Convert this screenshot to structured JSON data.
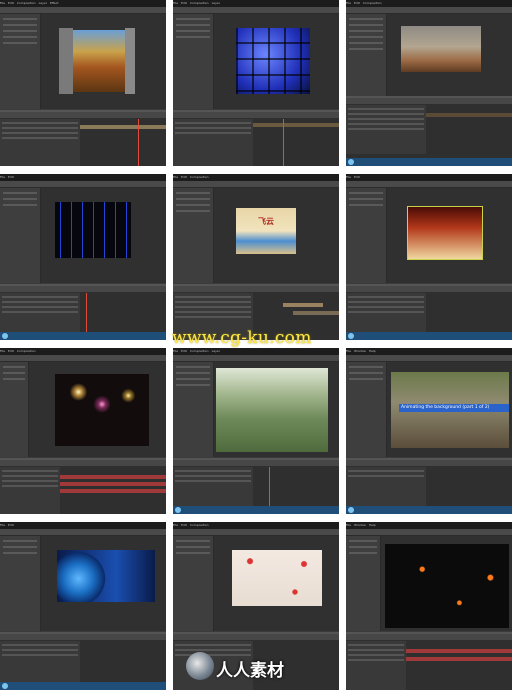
{
  "menu_items": [
    "File",
    "Edit",
    "Composition",
    "Layer",
    "Effect",
    "Animation",
    "View",
    "Window",
    "Help"
  ],
  "watermark_text": "www.cg-ku.com",
  "logo_text": "人人素材",
  "overlay_caption": "Animating the background (part 1 of 2)",
  "caption_tag": "飞云",
  "colors": {
    "app_background": "#3b3b3b",
    "timeline_background": "#2f2f2f",
    "taskbar": "#1f4f78",
    "playhead": "#e24b3b",
    "watermark": "#ffe84a",
    "caption_bar": "#2a63c9"
  },
  "tiles": [
    {
      "id": "tile-1",
      "preview": "autumn-forest-scene"
    },
    {
      "id": "tile-2",
      "preview": "blue-tile-grid"
    },
    {
      "id": "tile-3",
      "preview": "stone-ruins-scene"
    },
    {
      "id": "tile-4",
      "preview": "blue-falling-streaks"
    },
    {
      "id": "tile-5",
      "preview": "parchment-title-card"
    },
    {
      "id": "tile-6",
      "preview": "perspective-tiled-floor"
    },
    {
      "id": "tile-7",
      "preview": "star-lens-flares"
    },
    {
      "id": "tile-8",
      "preview": "highway-with-doves"
    },
    {
      "id": "tile-9",
      "preview": "stone-turtle-statue"
    },
    {
      "id": "tile-10",
      "preview": "glowing-earth-globe"
    },
    {
      "id": "tile-11",
      "preview": "red-petals-title"
    },
    {
      "id": "tile-12",
      "preview": "orange-particles-photos"
    }
  ]
}
